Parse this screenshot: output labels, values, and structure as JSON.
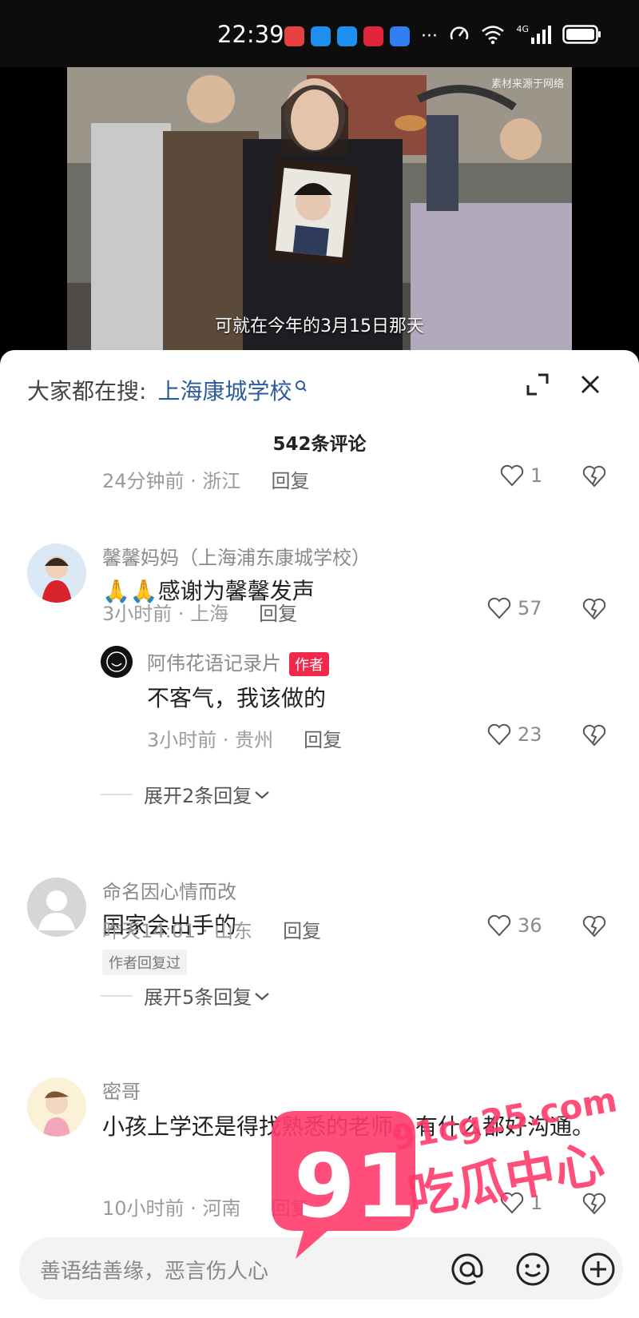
{
  "status_bar": {
    "time": "22:39",
    "network": "4G",
    "icons": [
      "speed-icon",
      "wifi-icon",
      "signal-icon",
      "battery-icon"
    ],
    "app_icon_colors": [
      "#e64040",
      "#1f8ef1",
      "#1f8ef1",
      "#e0253a",
      "#2f7ff0"
    ],
    "more": "···"
  },
  "video": {
    "watermark": "素材来源于网络",
    "caption": "可就在今年的3月15日那天"
  },
  "sheet": {
    "search_label": "大家都在搜:",
    "search_keyword": "上海康城学校",
    "comment_count": "542条评论"
  },
  "comments": [
    {
      "meta": "24分钟前 · 浙江",
      "reply": "回复",
      "likes": "1"
    },
    {
      "user": "馨馨妈妈（上海浦东康城学校）",
      "text": "🙏🙏感谢为馨馨发声",
      "meta": "3小时前 · 上海",
      "reply": "回复",
      "likes": "57",
      "reply_item": {
        "user": "阿伟花语记录片",
        "badge": "作者",
        "text": "不客气，我该做的",
        "meta": "3小时前 · 贵州",
        "reply": "回复",
        "likes": "23"
      },
      "expand": "展开2条回复"
    },
    {
      "user": "命名因心情而改",
      "text": "国家会出手的",
      "meta": "昨天14:01 · 山东",
      "reply": "回复",
      "likes": "36",
      "tag": "作者回复过",
      "expand": "展开5条回复"
    },
    {
      "user": "密哥",
      "text": "小孩上学还是得找熟悉的老师，有什么都好沟通。",
      "meta": "10小时前 · 河南",
      "reply": "回复",
      "likes": "1"
    }
  ],
  "input": {
    "placeholder": "善语结善缘，恶言伤人心",
    "icons": [
      "at-icon",
      "emoji-icon",
      "add-icon"
    ]
  },
  "overlay_watermark": {
    "number": "91",
    "url": "91cg25.com",
    "text": "吃瓜中心",
    "color": "#ff3b6b"
  }
}
